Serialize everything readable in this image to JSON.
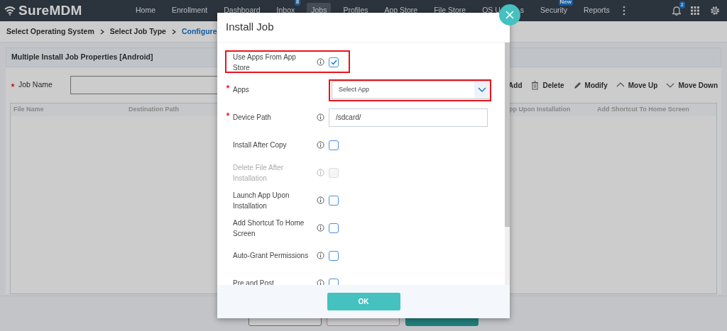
{
  "nav": {
    "logo": "SureMDM",
    "items": [
      {
        "label": "Home",
        "selected": false
      },
      {
        "label": "Enrollment",
        "selected": false
      },
      {
        "label": "Dashboard",
        "selected": false
      },
      {
        "label": "Inbox",
        "selected": false,
        "badge": "8"
      },
      {
        "label": "Jobs",
        "selected": true
      },
      {
        "label": "Profiles",
        "selected": false
      },
      {
        "label": "App Store",
        "selected": false
      },
      {
        "label": "File Store",
        "selected": false
      },
      {
        "label": "OS U",
        "label_end": "s",
        "selected": false
      },
      {
        "label": "Security",
        "selected": false,
        "badge": "New"
      },
      {
        "label": "Reports",
        "selected": false
      }
    ],
    "notification_count": "2"
  },
  "breadcrumb": [
    {
      "label": "Select Operating System",
      "selected": false
    },
    {
      "label": "Select Job Type",
      "selected": false
    },
    {
      "label": "Configure",
      "selected": true
    }
  ],
  "panel": {
    "title": "Multiple Install Job Properties [Android]"
  },
  "job_name": {
    "label": "Job Name",
    "required": true
  },
  "toolbar": [
    {
      "label": "Add",
      "kind": "plain"
    },
    {
      "label": "Delete",
      "kind": "trash"
    },
    {
      "label": "Modify",
      "kind": "pencil"
    },
    {
      "label": "Move Up",
      "kind": "up"
    },
    {
      "label": "Move Down",
      "kind": "down"
    }
  ],
  "table": {
    "columns": [
      "File Name",
      "Destination Path",
      "pp Upon Installation",
      "Add Shortcut To Home Screen"
    ]
  },
  "modal": {
    "title": "Install Job",
    "fields": [
      {
        "label": "Use Apps From App Store",
        "kind": "checkbox",
        "required": false,
        "info": true,
        "checked": true,
        "disabled": false,
        "highlighted": true
      },
      {
        "label": "Apps",
        "kind": "select",
        "required": true,
        "info": false,
        "placeholder": "Select App",
        "highlighted": true
      },
      {
        "label": "Device Path",
        "kind": "text",
        "required": true,
        "info": true,
        "value": "/sdcard/",
        "highlighted": false
      },
      {
        "label": "Install After Copy",
        "kind": "checkbox",
        "required": false,
        "info": true,
        "checked": false,
        "disabled": false,
        "highlighted": false
      },
      {
        "label": "Delete File After Installation",
        "kind": "checkbox",
        "required": false,
        "info": true,
        "checked": false,
        "disabled": true,
        "highlighted": false
      },
      {
        "label": "Launch App Upon Installation",
        "kind": "checkbox",
        "required": false,
        "info": true,
        "checked": false,
        "disabled": false,
        "highlighted": false
      },
      {
        "label": "Add Shortcut To Home Screen",
        "kind": "checkbox",
        "required": false,
        "info": true,
        "checked": false,
        "disabled": false,
        "highlighted": false
      },
      {
        "label": "Auto-Grant Permissions",
        "kind": "checkbox",
        "required": false,
        "info": true,
        "checked": false,
        "disabled": false,
        "highlighted": false
      },
      {
        "label": "Pre and Post",
        "kind": "checkbox",
        "required": false,
        "info": true,
        "checked": false,
        "disabled": false,
        "highlighted": false
      }
    ],
    "ok": "OK"
  }
}
